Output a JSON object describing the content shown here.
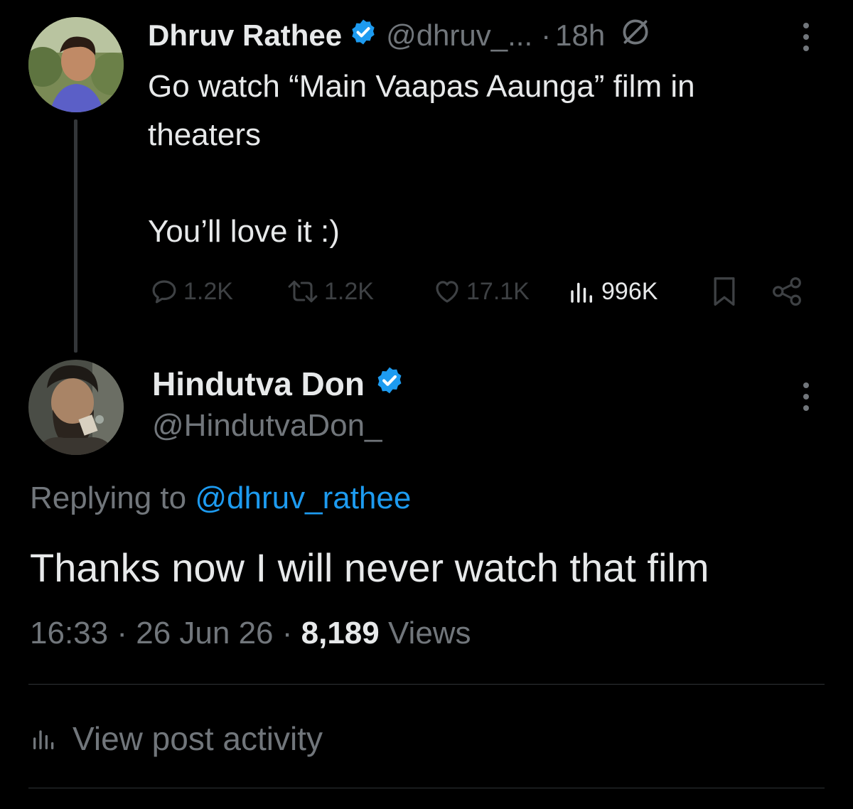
{
  "original_tweet": {
    "author_name": "Dhruv Rathee",
    "handle": "@dhruv_...",
    "separator": "·",
    "time": "18h",
    "text_line1": "Go watch “Main Vaapas Aaunga” film in",
    "text_line2": "theaters",
    "text_line3": "You’ll love it :)",
    "stats": {
      "replies": "1.2K",
      "reposts": "1.2K",
      "likes": "17.1K",
      "views": "996K"
    }
  },
  "reply_tweet": {
    "author_name": "Hindutva Don",
    "handle": "@HindutvaDon_",
    "replying_prefix": "Replying to",
    "replying_to": "@dhruv_rathee",
    "text": "Thanks now I will never watch that film",
    "time": "16:33",
    "separator": "·",
    "date": "26 Jun 26",
    "view_count": "8,189",
    "views_label": "Views"
  },
  "post_activity_label": "View post activity",
  "colors": {
    "background": "#000000",
    "text": "#e7e9ea",
    "muted": "#71767b",
    "accent": "#1d9bf0",
    "divider": "#2f3336"
  },
  "icons": [
    "verified-badge-icon",
    "edited-icon",
    "more-icon",
    "reply-icon",
    "repost-icon",
    "like-icon",
    "views-icon",
    "bookmark-icon",
    "share-icon"
  ]
}
